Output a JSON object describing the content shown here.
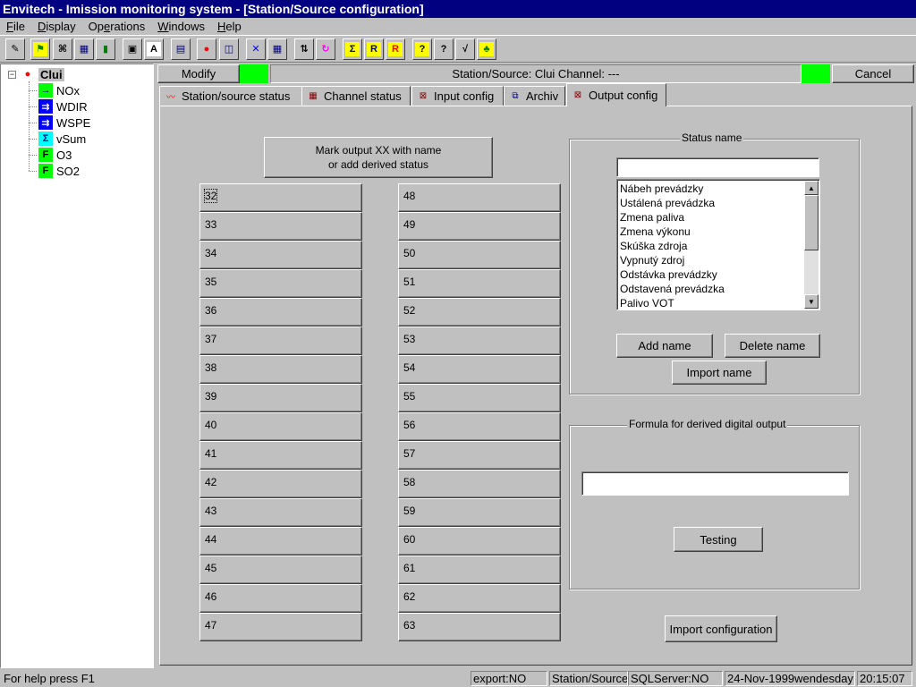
{
  "window": {
    "title": "Envitech - Imission  monitoring system - [Station/Source configuration]"
  },
  "menu": {
    "items": [
      {
        "pre": "",
        "u": "F",
        "post": "ile"
      },
      {
        "pre": "",
        "u": "D",
        "post": "isplay"
      },
      {
        "pre": "Op",
        "u": "e",
        "post": "rations"
      },
      {
        "pre": "",
        "u": "W",
        "post": "indows"
      },
      {
        "pre": "",
        "u": "H",
        "post": "elp"
      }
    ]
  },
  "toolbar": {
    "buttons": [
      {
        "icon": "pencil-icon",
        "glyph": "✎",
        "color": "#000000",
        "bg": "#c0c0c0"
      },
      {
        "icon": "station-map-icon",
        "glyph": "⚑",
        "color": "#008000",
        "bg": "#ffff00"
      },
      {
        "icon": "network-icon",
        "glyph": "⌘",
        "color": "#000000",
        "bg": "#c0c0c0"
      },
      {
        "icon": "grid-chart-icon",
        "glyph": "▦",
        "color": "#000080",
        "bg": "#c0c0c0"
      },
      {
        "icon": "bar-chart-icon",
        "glyph": "▮",
        "color": "#008000",
        "bg": "#c0c0c0"
      },
      {
        "icon": "save-disk-icon",
        "glyph": "▣",
        "color": "#000000",
        "bg": "#c0c0c0"
      },
      {
        "icon": "text-a-icon",
        "glyph": "A",
        "color": "#000000",
        "bg": "#ffffff"
      },
      {
        "icon": "document-window-icon",
        "glyph": "▤",
        "color": "#000080",
        "bg": "#c0c0c0"
      },
      {
        "icon": "traffic-light-icon",
        "glyph": "●",
        "color": "#ff0000",
        "bg": "#c0c0c0"
      },
      {
        "icon": "window-copy-icon",
        "glyph": "◫",
        "color": "#000080",
        "bg": "#c0c0c0"
      },
      {
        "icon": "cross-arrows-icon",
        "glyph": "✕",
        "color": "#0000ff",
        "bg": "#c0c0c0"
      },
      {
        "icon": "table-icon",
        "glyph": "▦",
        "color": "#000080",
        "bg": "#c0c0c0"
      },
      {
        "icon": "sort-icon",
        "glyph": "⇅",
        "color": "#000000",
        "bg": "#c0c0c0"
      },
      {
        "icon": "refresh-icon",
        "glyph": "↻",
        "color": "#ff00ff",
        "bg": "#c0c0c0"
      },
      {
        "icon": "sum-icon",
        "glyph": "Σ",
        "color": "#000080",
        "bg": "#ffff00"
      },
      {
        "icon": "r-icon",
        "glyph": "R",
        "color": "#000080",
        "bg": "#ffff00"
      },
      {
        "icon": "r-cross-icon",
        "glyph": "R",
        "color": "#ff0000",
        "bg": "#ffff00"
      },
      {
        "icon": "help-icon",
        "glyph": "?",
        "color": "#000000",
        "bg": "#ffff00"
      },
      {
        "icon": "context-help-icon",
        "glyph": "?",
        "color": "#000000",
        "bg": "#c0c0c0"
      },
      {
        "icon": "chart-window-icon",
        "glyph": "√",
        "color": "#000000",
        "bg": "#c0c0c0"
      },
      {
        "icon": "station-group-icon",
        "glyph": "♣",
        "color": "#008000",
        "bg": "#ffff00"
      }
    ]
  },
  "tree": {
    "root": {
      "label": "Clui",
      "icon": "traffic-light-icon",
      "glyph": "●"
    },
    "expander": "−",
    "children": [
      {
        "label": "NOx",
        "icon": "arrow-right-icon",
        "glyph": "→",
        "color": "#000080",
        "bg": "#00ff00"
      },
      {
        "label": "WDIR",
        "icon": "wind-arrow-icon",
        "glyph": "⇉",
        "color": "#ffffff",
        "bg": "#0000ff"
      },
      {
        "label": "WSPE",
        "icon": "wind-arrow-icon",
        "glyph": "⇉",
        "color": "#ffffff",
        "bg": "#0000ff"
      },
      {
        "label": "vSum",
        "icon": "sum-icon",
        "glyph": "Σ",
        "color": "#000080",
        "bg": "#00ffff"
      },
      {
        "label": "O3",
        "icon": "formula-f-icon",
        "glyph": "F",
        "color": "#000000",
        "bg": "#00ff00"
      },
      {
        "label": "SO2",
        "icon": "formula-f-icon",
        "glyph": "F",
        "color": "#000000",
        "bg": "#00ff00"
      }
    ]
  },
  "header": {
    "modify_label": "Modify",
    "info": "Station/Source: Clui  Channel: ---",
    "cancel_label": "Cancel",
    "indicator_color": "#00ff00"
  },
  "tabs": [
    {
      "label": "Station/source status",
      "icon": "wave-icon",
      "glyph": "〰",
      "color": "#ff0000"
    },
    {
      "label": "Channel status",
      "icon": "table-icon",
      "glyph": "▦",
      "color": "#800000"
    },
    {
      "label": "Input config",
      "icon": "input-config-icon",
      "glyph": "⊠",
      "color": "#800000"
    },
    {
      "label": "Archiv",
      "icon": "archive-icon",
      "glyph": "⧉",
      "color": "#000080"
    },
    {
      "label": "Output config",
      "icon": "output-config-icon",
      "glyph": "⊠",
      "color": "#800000",
      "active": true
    }
  ],
  "output": {
    "mark_button": {
      "line1": "Mark output XX with name",
      "line2": "or add derived status"
    },
    "left_outputs": [
      "32",
      "33",
      "34",
      "35",
      "36",
      "37",
      "38",
      "39",
      "40",
      "41",
      "42",
      "43",
      "44",
      "45",
      "46",
      "47"
    ],
    "right_outputs": [
      "48",
      "49",
      "50",
      "51",
      "52",
      "53",
      "54",
      "55",
      "56",
      "57",
      "58",
      "59",
      "60",
      "61",
      "62",
      "63"
    ],
    "focused_output": "32"
  },
  "status_name": {
    "title": "Status name",
    "input_value": "",
    "list": [
      "Nábeh prevádzky",
      "Ustálená prevádzka",
      "Zmena paliva",
      "Zmena výkonu",
      "Skúška zdroja",
      "Vypnutý zdroj",
      "Odstávka prevádzky",
      "Odstavená prevádzka",
      "Palivo VOT"
    ],
    "add_label": "Add name",
    "delete_label": "Delete name",
    "import_label": "Import name",
    "scroll_up": "▲",
    "scroll_down": "▼"
  },
  "formula": {
    "title": "Formula for derived digital output",
    "input_value": "",
    "testing_label": "Testing"
  },
  "import_config_label": "Import configuration",
  "statusbar": {
    "help": "For help press F1",
    "export": "export:NO",
    "station": "Station/Source",
    "sql": "SQLServer:NO",
    "date": "24-Nov-1999wendesday",
    "time": "20:15:07"
  }
}
